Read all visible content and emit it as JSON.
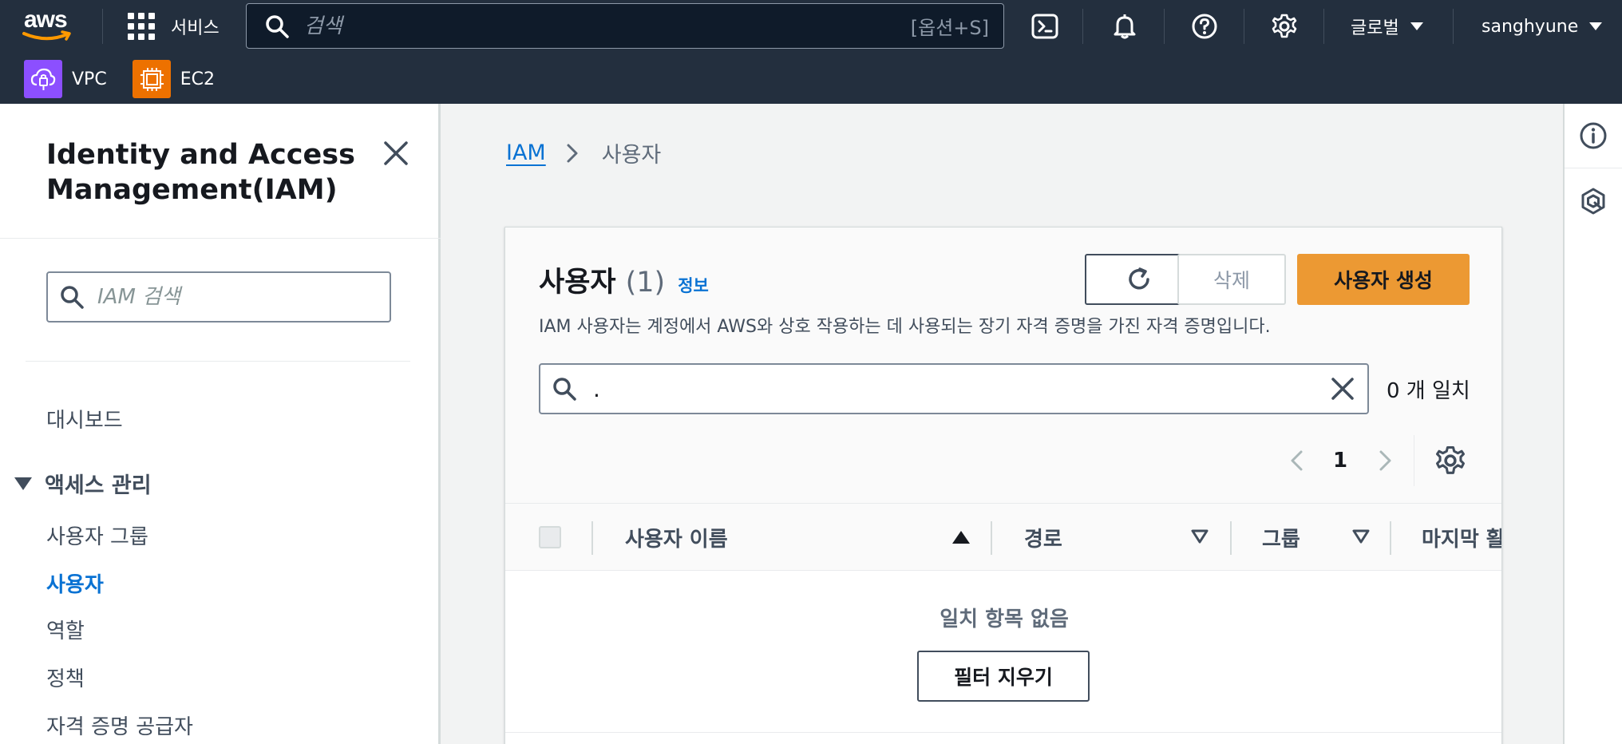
{
  "nav": {
    "logo_text": "aws",
    "services_label": "서비스",
    "search_placeholder": "검색",
    "search_shortcut": "[옵션+S]",
    "region_label": "글로벌",
    "user_label": "sanghyune",
    "favorites": [
      {
        "label": "VPC",
        "icon": "vpc-icon",
        "color": "#8c4fff"
      },
      {
        "label": "EC2",
        "icon": "ec2-icon",
        "color": "#ed7100"
      }
    ]
  },
  "sidebar": {
    "title": "Identity and Access Management(IAM)",
    "search_placeholder": "IAM 검색",
    "dashboard": "대시보드",
    "section_access": "액세스 관리",
    "items": [
      {
        "label": "사용자 그룹"
      },
      {
        "label": "사용자",
        "active": true
      },
      {
        "label": "역할"
      },
      {
        "label": "정책"
      },
      {
        "label": "자격 증명 공급자"
      }
    ]
  },
  "breadcrumb": {
    "root": "IAM",
    "current": "사용자"
  },
  "users_panel": {
    "title": "사용자",
    "count": "(1)",
    "info_link": "정보",
    "description": "IAM 사용자는 계정에서 AWS와 상호 작용하는 데 사용되는 장기 자격 증명을 가진 자격 증명입니다.",
    "delete_label": "삭제",
    "create_label": "사용자 생성",
    "filter_value": ".",
    "match_text": "0 개 일치",
    "page_number": "1",
    "columns": [
      "사용자 이름",
      "경로",
      "그룹",
      "마지막 활"
    ],
    "empty_text": "일치 항목 없음",
    "clear_filter_label": "필터 지우기"
  },
  "colors": {
    "nav_bg": "#232f3e",
    "primary_button": "#ec9933",
    "link": "#0972d3"
  }
}
